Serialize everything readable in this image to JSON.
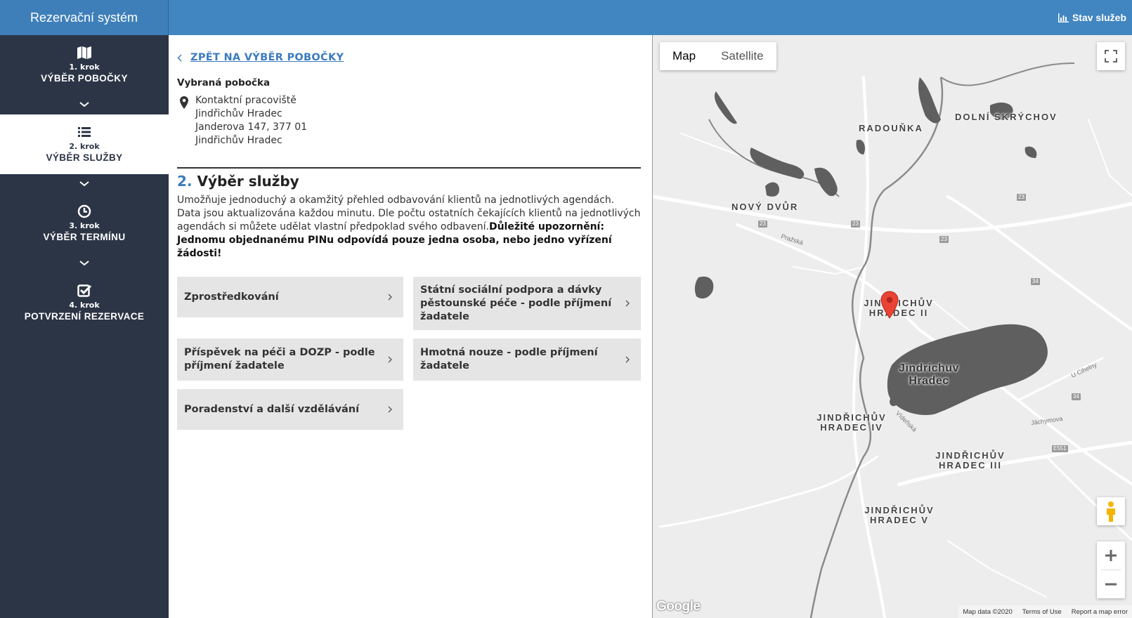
{
  "header": {
    "brand": "Rezervační systém",
    "status_link": "Stav služeb"
  },
  "sidebar": {
    "steps": [
      {
        "num": "1. krok",
        "title": "VÝBĚR POBOČKY",
        "icon": "map-icon",
        "active": false
      },
      {
        "num": "2. krok",
        "title": "VÝBĚR SLUŽBY",
        "icon": "list-icon",
        "active": true
      },
      {
        "num": "3. krok",
        "title": "VÝBĚR TERMÍNU",
        "icon": "clock-icon",
        "active": false
      },
      {
        "num": "4. krok",
        "title": "POTVRZENÍ REZERVACE",
        "icon": "checkbox-icon",
        "active": false
      }
    ]
  },
  "content": {
    "back_link": "ZPĚT NA VÝBĚR POBOČKY",
    "branch_label": "Vybraná pobočka",
    "branch_lines": [
      "Kontaktní pracoviště",
      "Jindřichův Hradec",
      "Janderova 147, 377 01",
      "Jindřichův Hradec"
    ],
    "section_num": "2.",
    "section_title": "Výběr služby",
    "desc_normal": "Umožňuje jednoduchý a okamžitý přehled odbavování klientů na jednotlivých agendách. Data jsou aktualizována každou minutu. Dle počtu ostatních čekajících klientů na jednotlivých agendách si můžete udělat vlastní předpoklad svého odbavení.",
    "desc_bold": "Důležité upozornění: Jednomu objednanému PINu odpovídá pouze jedna osoba, nebo jedno vyřízení žádosti!",
    "services": [
      "Zprostředkování",
      "Státní sociální podpora a dávky pěstounské péče - podle příjmení žadatele",
      "Příspěvek na péči a DOZP - podle příjmení žadatele",
      "Hmotná nouze - podle příjmení žadatele",
      "Poradenství a další vzdělávání"
    ]
  },
  "map": {
    "type_map": "Map",
    "type_satellite": "Satellite",
    "labels": {
      "radounka": "RADOUŇKA",
      "dolni_skrychov": "DOLNÍ SKRÝCHOV",
      "novy_dvur": "NOVÝ DVŮR",
      "jh2": "JINDŘICHŮV HRADEC II",
      "city": "Jindrichuv Hradec",
      "jh4": "JINDŘICHŮV HRADEC IV",
      "jh3": "JINDŘICHŮV HRADEC III",
      "jh5": "JINDŘICHŮV HRADEC V"
    },
    "streets": {
      "prazska": "Pražská",
      "vodnanska": "Vídeňská",
      "jachymova": "Jáchymova",
      "u_cihelny": "U Cihelny"
    },
    "roads": {
      "r23": "23",
      "r34": "34",
      "e551": "E551"
    },
    "google": "Google",
    "footer": {
      "data": "Map data ©2020",
      "terms": "Terms of Use",
      "report": "Report a map error"
    }
  },
  "colors": {
    "accent": "#4186c1",
    "sidebar": "#2c3546",
    "tile": "#e5e5e5",
    "pin": "#ea4335"
  }
}
